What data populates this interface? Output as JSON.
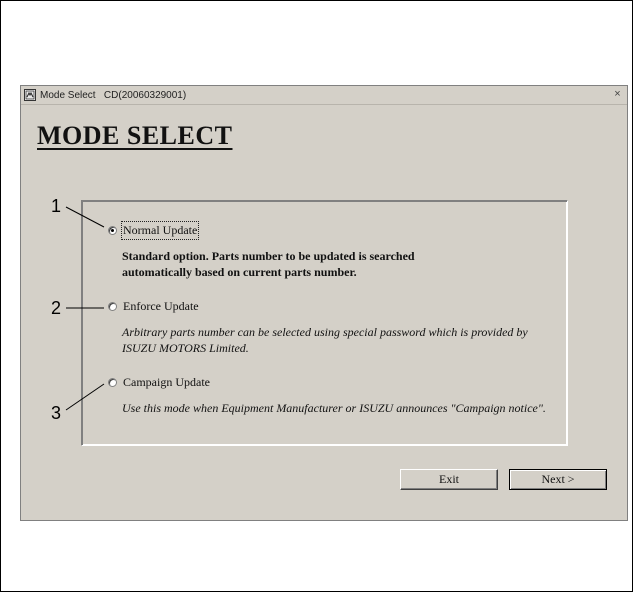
{
  "window": {
    "title": "Mode Select   CD(20060329001)",
    "close_glyph": "×",
    "icon": "app-icon"
  },
  "heading": "MODE SELECT",
  "options": [
    {
      "number": "1",
      "label": "Normal Update",
      "selected": true,
      "description": "Standard option. Parts number to be updated is searched automatically based on current parts number."
    },
    {
      "number": "2",
      "label": "Enforce Update",
      "selected": false,
      "description": "Arbitrary parts number can be selected using special password which is provided by ISUZU MOTORS Limited."
    },
    {
      "number": "3",
      "label": "Campaign Update",
      "selected": false,
      "description": "Use this mode when Equipment Manufacturer or ISUZU announces \"Campaign notice\"."
    }
  ],
  "buttons": {
    "exit_label": "Exit",
    "next_label": "Next >"
  },
  "colors": {
    "window_bg": "#d4d0c8",
    "page_bg": "#ffffff"
  }
}
